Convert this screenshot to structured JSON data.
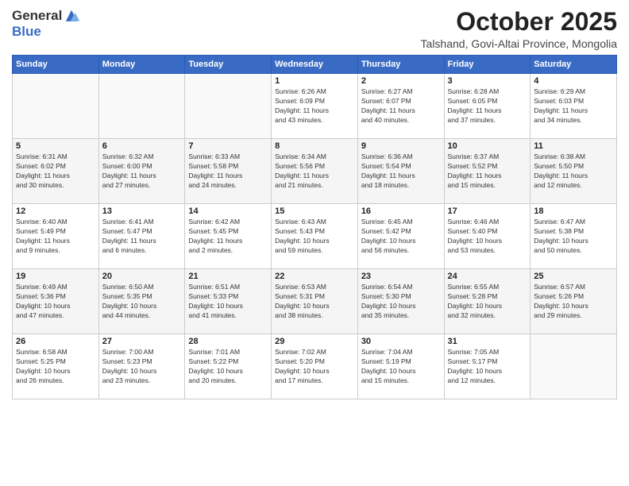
{
  "header": {
    "logo_line1": "General",
    "logo_line2": "Blue",
    "month_title": "October 2025",
    "location": "Talshand, Govi-Altai Province, Mongolia"
  },
  "weekdays": [
    "Sunday",
    "Monday",
    "Tuesday",
    "Wednesday",
    "Thursday",
    "Friday",
    "Saturday"
  ],
  "weeks": [
    [
      {
        "day": "",
        "info": ""
      },
      {
        "day": "",
        "info": ""
      },
      {
        "day": "",
        "info": ""
      },
      {
        "day": "1",
        "info": "Sunrise: 6:26 AM\nSunset: 6:09 PM\nDaylight: 11 hours\nand 43 minutes."
      },
      {
        "day": "2",
        "info": "Sunrise: 6:27 AM\nSunset: 6:07 PM\nDaylight: 11 hours\nand 40 minutes."
      },
      {
        "day": "3",
        "info": "Sunrise: 6:28 AM\nSunset: 6:05 PM\nDaylight: 11 hours\nand 37 minutes."
      },
      {
        "day": "4",
        "info": "Sunrise: 6:29 AM\nSunset: 6:03 PM\nDaylight: 11 hours\nand 34 minutes."
      }
    ],
    [
      {
        "day": "5",
        "info": "Sunrise: 6:31 AM\nSunset: 6:02 PM\nDaylight: 11 hours\nand 30 minutes."
      },
      {
        "day": "6",
        "info": "Sunrise: 6:32 AM\nSunset: 6:00 PM\nDaylight: 11 hours\nand 27 minutes."
      },
      {
        "day": "7",
        "info": "Sunrise: 6:33 AM\nSunset: 5:58 PM\nDaylight: 11 hours\nand 24 minutes."
      },
      {
        "day": "8",
        "info": "Sunrise: 6:34 AM\nSunset: 5:56 PM\nDaylight: 11 hours\nand 21 minutes."
      },
      {
        "day": "9",
        "info": "Sunrise: 6:36 AM\nSunset: 5:54 PM\nDaylight: 11 hours\nand 18 minutes."
      },
      {
        "day": "10",
        "info": "Sunrise: 6:37 AM\nSunset: 5:52 PM\nDaylight: 11 hours\nand 15 minutes."
      },
      {
        "day": "11",
        "info": "Sunrise: 6:38 AM\nSunset: 5:50 PM\nDaylight: 11 hours\nand 12 minutes."
      }
    ],
    [
      {
        "day": "12",
        "info": "Sunrise: 6:40 AM\nSunset: 5:49 PM\nDaylight: 11 hours\nand 9 minutes."
      },
      {
        "day": "13",
        "info": "Sunrise: 6:41 AM\nSunset: 5:47 PM\nDaylight: 11 hours\nand 6 minutes."
      },
      {
        "day": "14",
        "info": "Sunrise: 6:42 AM\nSunset: 5:45 PM\nDaylight: 11 hours\nand 2 minutes."
      },
      {
        "day": "15",
        "info": "Sunrise: 6:43 AM\nSunset: 5:43 PM\nDaylight: 10 hours\nand 59 minutes."
      },
      {
        "day": "16",
        "info": "Sunrise: 6:45 AM\nSunset: 5:42 PM\nDaylight: 10 hours\nand 56 minutes."
      },
      {
        "day": "17",
        "info": "Sunrise: 6:46 AM\nSunset: 5:40 PM\nDaylight: 10 hours\nand 53 minutes."
      },
      {
        "day": "18",
        "info": "Sunrise: 6:47 AM\nSunset: 5:38 PM\nDaylight: 10 hours\nand 50 minutes."
      }
    ],
    [
      {
        "day": "19",
        "info": "Sunrise: 6:49 AM\nSunset: 5:36 PM\nDaylight: 10 hours\nand 47 minutes."
      },
      {
        "day": "20",
        "info": "Sunrise: 6:50 AM\nSunset: 5:35 PM\nDaylight: 10 hours\nand 44 minutes."
      },
      {
        "day": "21",
        "info": "Sunrise: 6:51 AM\nSunset: 5:33 PM\nDaylight: 10 hours\nand 41 minutes."
      },
      {
        "day": "22",
        "info": "Sunrise: 6:53 AM\nSunset: 5:31 PM\nDaylight: 10 hours\nand 38 minutes."
      },
      {
        "day": "23",
        "info": "Sunrise: 6:54 AM\nSunset: 5:30 PM\nDaylight: 10 hours\nand 35 minutes."
      },
      {
        "day": "24",
        "info": "Sunrise: 6:55 AM\nSunset: 5:28 PM\nDaylight: 10 hours\nand 32 minutes."
      },
      {
        "day": "25",
        "info": "Sunrise: 6:57 AM\nSunset: 5:26 PM\nDaylight: 10 hours\nand 29 minutes."
      }
    ],
    [
      {
        "day": "26",
        "info": "Sunrise: 6:58 AM\nSunset: 5:25 PM\nDaylight: 10 hours\nand 26 minutes."
      },
      {
        "day": "27",
        "info": "Sunrise: 7:00 AM\nSunset: 5:23 PM\nDaylight: 10 hours\nand 23 minutes."
      },
      {
        "day": "28",
        "info": "Sunrise: 7:01 AM\nSunset: 5:22 PM\nDaylight: 10 hours\nand 20 minutes."
      },
      {
        "day": "29",
        "info": "Sunrise: 7:02 AM\nSunset: 5:20 PM\nDaylight: 10 hours\nand 17 minutes."
      },
      {
        "day": "30",
        "info": "Sunrise: 7:04 AM\nSunset: 5:19 PM\nDaylight: 10 hours\nand 15 minutes."
      },
      {
        "day": "31",
        "info": "Sunrise: 7:05 AM\nSunset: 5:17 PM\nDaylight: 10 hours\nand 12 minutes."
      },
      {
        "day": "",
        "info": ""
      }
    ]
  ]
}
